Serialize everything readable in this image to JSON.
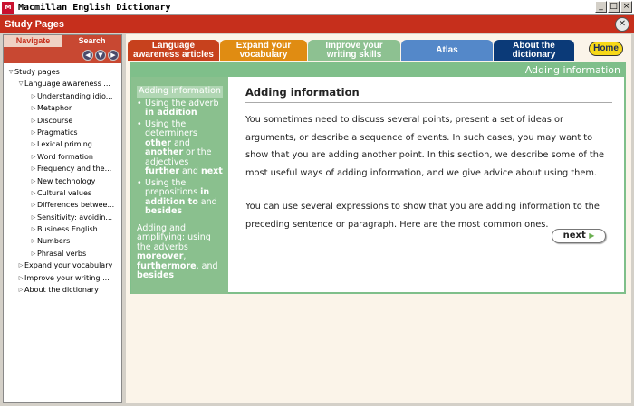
{
  "window": {
    "icon_label": "M",
    "title": "Macmillan English Dictionary",
    "min": "_",
    "max": "□",
    "close": "×"
  },
  "study_bar": {
    "title": "Study Pages",
    "close": "✕"
  },
  "left": {
    "tabs": {
      "navigate": "Navigate",
      "search": "Search"
    },
    "arrows": {
      "back": "◀",
      "down": "▼",
      "forward": "▶"
    },
    "tree": [
      {
        "level": 0,
        "twisty": "▽",
        "label": "Study pages"
      },
      {
        "level": 1,
        "twisty": "▽",
        "label": "Language awareness ..."
      },
      {
        "level": 2,
        "twisty": "▷",
        "label": "Understanding idio..."
      },
      {
        "level": 2,
        "twisty": "▷",
        "label": "Metaphor"
      },
      {
        "level": 2,
        "twisty": "▷",
        "label": "Discourse"
      },
      {
        "level": 2,
        "twisty": "▷",
        "label": "Pragmatics"
      },
      {
        "level": 2,
        "twisty": "▷",
        "label": "Lexical priming"
      },
      {
        "level": 2,
        "twisty": "▷",
        "label": "Word formation"
      },
      {
        "level": 2,
        "twisty": "▷",
        "label": "Frequency and the..."
      },
      {
        "level": 2,
        "twisty": "▷",
        "label": "New technology"
      },
      {
        "level": 2,
        "twisty": "▷",
        "label": "Cultural values"
      },
      {
        "level": 2,
        "twisty": "▷",
        "label": "Differences betwee..."
      },
      {
        "level": 2,
        "twisty": "▷",
        "label": "Sensitivity: avoidin..."
      },
      {
        "level": 2,
        "twisty": "▷",
        "label": "Business English"
      },
      {
        "level": 2,
        "twisty": "▷",
        "label": "Numbers"
      },
      {
        "level": 2,
        "twisty": "▷",
        "label": "Phrasal verbs"
      },
      {
        "level": 1,
        "twisty": "▷",
        "label": "Expand your vocabulary"
      },
      {
        "level": 1,
        "twisty": "▷",
        "label": "Improve your writing ..."
      },
      {
        "level": 1,
        "twisty": "▷",
        "label": "About the dictionary"
      }
    ]
  },
  "tabs": {
    "lang_1": "Language",
    "lang_2": "awareness articles",
    "vocab_1": "Expand your",
    "vocab_2": "vocabulary",
    "writing_1": "Improve your",
    "writing_2": "writing skills",
    "atlas": "Atlas",
    "dict_1": "About the",
    "dict_2": "dictionary",
    "home": "Home"
  },
  "content": {
    "header": "Adding information",
    "side": {
      "active": "Adding information",
      "bullet": "•",
      "item1_pre": "Using the adverb ",
      "item1_b": "in addition",
      "item2_pre": "Using the determiners ",
      "item2_b1": "other",
      "item2_mid1": " and ",
      "item2_b2": "another",
      "item2_mid2": " or the adjectives ",
      "item2_b3": "further",
      "item2_mid3": " and ",
      "item2_b4": "next",
      "item3_pre": "Using the prepositions ",
      "item3_b1": "in addition to",
      "item3_mid": " and ",
      "item3_b2": "besides",
      "para_pre": "Adding and amplifying: using the adverbs ",
      "para_b1": "moreover",
      "para_mid1": ", ",
      "para_b2": "furthermore",
      "para_mid2": ", and ",
      "para_b3": "besides"
    },
    "title": "Adding information",
    "para1": "You sometimes need to discuss several points, present a set of ideas or arguments, or describe a sequence of events. In such cases, you may want to show that you are adding another point. In this section, we describe some of the most useful ways of adding information, and we give advice about using them.",
    "para2": "You can use several expressions to show that you are adding information to the preceding sentence or paragraph. Here are the most common ones.",
    "next": "next",
    "next_arrow": "▶"
  },
  "colors": {
    "study_bar": "#c62f1c",
    "tab_lang": "#c7411d",
    "tab_vocab": "#e08c12",
    "tab_writing": "#8dc191",
    "tab_atlas": "#5488c9",
    "tab_dict": "#0b3a78",
    "home": "#f7d818",
    "green": "#7fbf8a"
  }
}
